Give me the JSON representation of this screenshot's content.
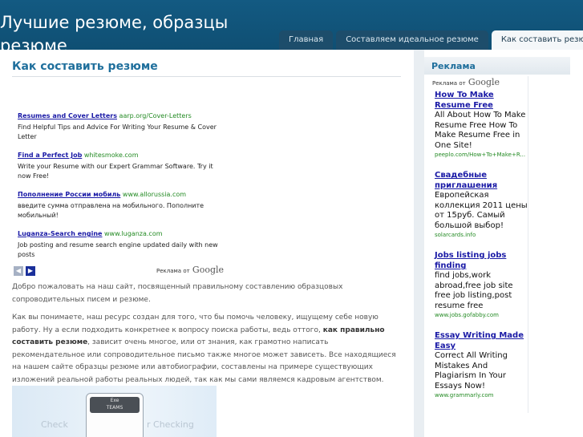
{
  "site": {
    "title": "Лучшие резюме, образцы резюме"
  },
  "nav": {
    "tabs": [
      {
        "label": "Главная"
      },
      {
        "label": "Составляем идеальное резюме"
      },
      {
        "label": "Как составить резюме"
      }
    ]
  },
  "main": {
    "title": "Как составить резюме",
    "ads": [
      {
        "title": "Resumes and Cover Letters",
        "url": "aarp.org/Cover-Letters",
        "desc": "Find Helpful Tips and Advice For Writing Your Resume & Cover Letter"
      },
      {
        "title": "Find a Perfect Job",
        "url": "whitesmoke.com",
        "desc": "Write your Resume with our Expert Grammar Software. Try it now Free!"
      },
      {
        "title": "Пополнение России мобиль",
        "url": "www.allorussia.com",
        "desc": "введите сумма отправлена на мобильного. Пополните мобильный!"
      },
      {
        "title": "Luganza-Search engine",
        "url": "www.luganza.com",
        "desc": "Job posting and resume search engine updated daily with new posts"
      }
    ],
    "ads_by": "Реклама от",
    "google": "Google",
    "arrow_prev": "◀",
    "arrow_next": "▶",
    "intro": "Добро пожаловать на наш сайт, посвященный правильному составлению образцовых сопроводительных писем и резюме.",
    "p2_before": "Как вы понимаете, наш ресурс создан для того, что бы помочь человеку, ищущему себе новую работу. Ну а если подходить конкретнее к вопросу поиска работы, ведь оттого, ",
    "p2_bold": "как правильно составить резюме",
    "p2_after": ", зависит очень многое, или от знания, как грамотно написать рекомендательное или сопроводительное письмо также многое может зависеть. Все находящиеся на нашем сайте образцы резюме или автобиографии, составлены на примере существующих изложений реальной работы реальных людей, так как мы сами являемся кадровым агентством.",
    "promo_badge_1": "Exe",
    "promo_badge_2": "TEAMS",
    "promo_faded_left": "Check",
    "promo_faded_right": "r Checking"
  },
  "sidebar": {
    "title": "Реклама",
    "ads": [
      {
        "title": "How To Make Resume Free",
        "text": "All About How To Make Resume Free How To Make Resume Free in One Site!",
        "url": "peeplo.com/How+To+Make+R..."
      },
      {
        "title": "Свадебные приглашения",
        "text": "Европейская коллекция 2011 цены от 15руб. Самый большой выбор!",
        "url": "solarcards.info"
      },
      {
        "title": "Jobs listing jobs finding",
        "text": "find jobs,work abroad,free job site free job listing,post resume free",
        "url": "www.jobs.gofabby.com"
      },
      {
        "title": "Essay Writing Made Easy",
        "text": "Correct All Writing Mistakes And Plagiarism In Your Essays Now!",
        "url": "www.grammarly.com"
      }
    ]
  }
}
